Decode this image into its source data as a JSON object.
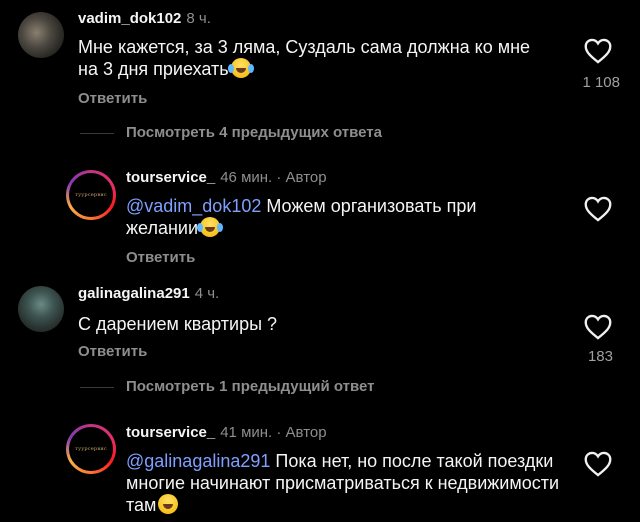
{
  "comments": [
    {
      "username": "vadim_dok102",
      "time": "8 ч.",
      "text": "Мне кажется, за 3 ляма, Суздаль сама должна ко мне на 3 дня приехать",
      "reply_label": "Ответить",
      "likes": "1 108",
      "view_replies": "Посмотреть 4 предыдущих ответа"
    },
    {
      "username": "tourservice_",
      "time": "46 мин. · Автор",
      "mention": "@vadim_dok102",
      "text": " Можем организовать при желании",
      "reply_label": "Ответить"
    },
    {
      "username": "galinagalina291",
      "time": "4 ч.",
      "text": "С дарением квартиры ?",
      "reply_label": "Ответить",
      "likes": "183",
      "view_replies": "Посмотреть 1 предыдущий ответ"
    },
    {
      "username": "tourservice_",
      "time": "41 мин. · Автор",
      "mention": "@galinagalina291",
      "text": " Пока нет, но после такой поездки многие начинают присматриваться к недвижимости там"
    }
  ],
  "icons": {
    "like": "heart-outline-icon",
    "emoji_laugh": "face-with-tears-of-joy-icon",
    "emoji_grin": "grinning-face-icon"
  },
  "colors": {
    "background": "#000000",
    "text": "#f5f5f5",
    "muted": "#8e8e8e",
    "mention": "#7ea0ff"
  },
  "brand_logo_text": "туурсервис"
}
